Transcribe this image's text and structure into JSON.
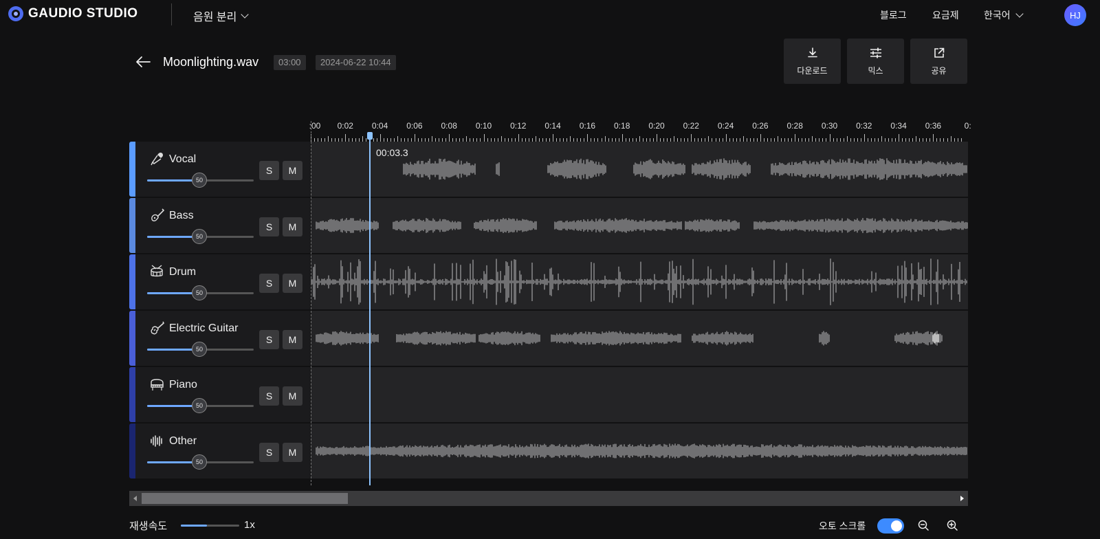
{
  "app": {
    "logo_text": "GAUDIO STUDIO",
    "menu_selected": "음원 분리"
  },
  "nav": {
    "blog": "블로그",
    "pricing": "요금제",
    "language": "한국어",
    "avatar": "HJ"
  },
  "file": {
    "name": "Moonlighting.wav",
    "duration": "03:00",
    "date": "2024-06-22 10:44"
  },
  "actions": [
    {
      "label": "다운로드",
      "icon": "download-icon"
    },
    {
      "label": "믹스",
      "icon": "mixer-sliders-icon"
    },
    {
      "label": "공유",
      "icon": "share-icon"
    }
  ],
  "ruler": {
    "labels": [
      ":00",
      "0:02",
      "0:04",
      "0:06",
      "0:08",
      "0:10",
      "0:12",
      "0:14",
      "0:16",
      "0:18",
      "0:20",
      "0:22",
      "0:24",
      "0:26",
      "0:28",
      "0:30",
      "0:32",
      "0:34",
      "0:36",
      "0:"
    ]
  },
  "playhead": {
    "timecode": "00:03.3"
  },
  "tracks": [
    {
      "name": "Vocal",
      "icon": "microphone-icon",
      "volume": "50",
      "solo": "S",
      "mute": "M",
      "accent": "#5b9cff",
      "has_audio": true
    },
    {
      "name": "Bass",
      "icon": "bass-guitar-icon",
      "volume": "50",
      "solo": "S",
      "mute": "M",
      "accent": "#5b8ae0",
      "has_audio": true
    },
    {
      "name": "Drum",
      "icon": "drum-icon",
      "volume": "50",
      "solo": "S",
      "mute": "M",
      "accent": "#4d72e8",
      "has_audio": true
    },
    {
      "name": "Electric Guitar",
      "icon": "electric-guitar-icon",
      "volume": "50",
      "solo": "S",
      "mute": "M",
      "accent": "#4a5fd8",
      "has_audio": true
    },
    {
      "name": "Piano",
      "icon": "piano-icon",
      "volume": "50",
      "solo": "S",
      "mute": "M",
      "accent": "#2e3fa8",
      "has_audio": false
    },
    {
      "name": "Other",
      "icon": "soundwave-icon",
      "volume": "50",
      "solo": "S",
      "mute": "M",
      "accent": "#1a2570",
      "has_audio": true
    }
  ],
  "footer": {
    "speed_label": "재생속도",
    "speed_value": "1x",
    "auto_scroll_label": "오토 스크롤",
    "auto_scroll_on": true
  }
}
